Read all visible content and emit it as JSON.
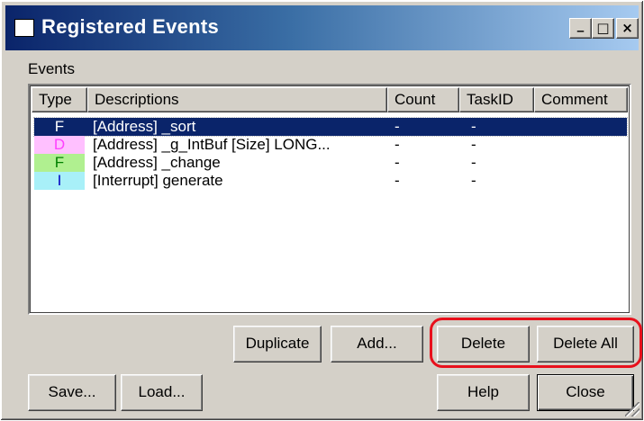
{
  "window": {
    "title": "Registered Events",
    "controls": {
      "minimize": "_",
      "maximize": "□",
      "close": "×"
    }
  },
  "events_group": {
    "label": "Events"
  },
  "columns": [
    "Type",
    "Descriptions",
    "Count",
    "TaskID",
    "Comment"
  ],
  "rows": [
    {
      "type": "F",
      "type_color": "#0000c0",
      "type_bg": "#0a246a",
      "description": "[Address] _sort",
      "count": "-",
      "taskid": "-",
      "comment": "",
      "selected": true
    },
    {
      "type": "D",
      "type_color": "#ff40ff",
      "type_bg": "#ffc0ff",
      "description": "[Address] _g_IntBuf [Size] LONG...",
      "count": "-",
      "taskid": "-",
      "comment": "",
      "selected": false
    },
    {
      "type": "F",
      "type_color": "#008000",
      "type_bg": "#b0f090",
      "description": "[Address] _change",
      "count": "-",
      "taskid": "-",
      "comment": "",
      "selected": false
    },
    {
      "type": "I",
      "type_color": "#0000c0",
      "type_bg": "#a8f0f8",
      "description": "[Interrupt] generate",
      "count": "-",
      "taskid": "-",
      "comment": "",
      "selected": false
    }
  ],
  "buttons": {
    "duplicate": "Duplicate",
    "add": "Add...",
    "delete": "Delete",
    "delete_all": "Delete All",
    "save": "Save...",
    "load": "Load...",
    "help": "Help",
    "close": "Close"
  },
  "colors": {
    "title_start": "#0a246a",
    "title_end": "#a6caf0",
    "selection": "#0a246a",
    "highlight_outline": "#e8101c"
  }
}
